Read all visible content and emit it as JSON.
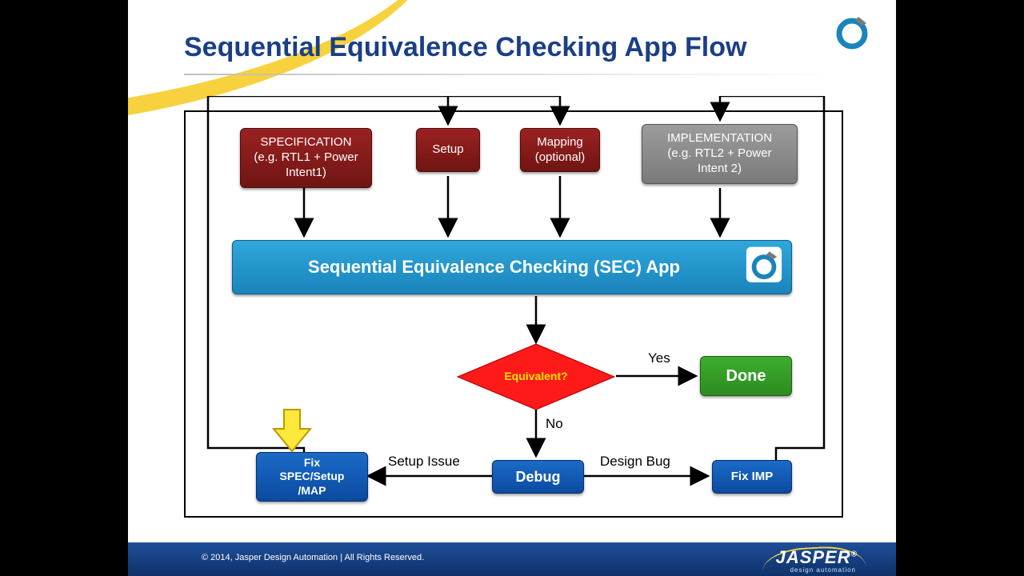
{
  "title": "Sequential Equivalence Checking App Flow",
  "nodes": {
    "spec": "SPECIFICATION\n(e.g. RTL1 + Power\nIntent1)",
    "setup": "Setup",
    "mapping": "Mapping\n(optional)",
    "impl": "IMPLEMENTATION\n(e.g. RTL2 + Power\nIntent 2)",
    "secapp": "Sequential Equivalence Checking (SEC) App",
    "decision": "Equivalent?",
    "done": "Done",
    "debug": "Debug",
    "fixspec": "Fix\nSPEC/Setup\n/MAP",
    "fiximp": "Fix IMP"
  },
  "labels": {
    "yes": "Yes",
    "no": "No",
    "setup_issue": "Setup Issue",
    "design_bug": "Design Bug"
  },
  "footer": "© 2014, Jasper Design Automation | All Rights Reserved.",
  "brand": "JASPER",
  "brand_sub": "design automation"
}
